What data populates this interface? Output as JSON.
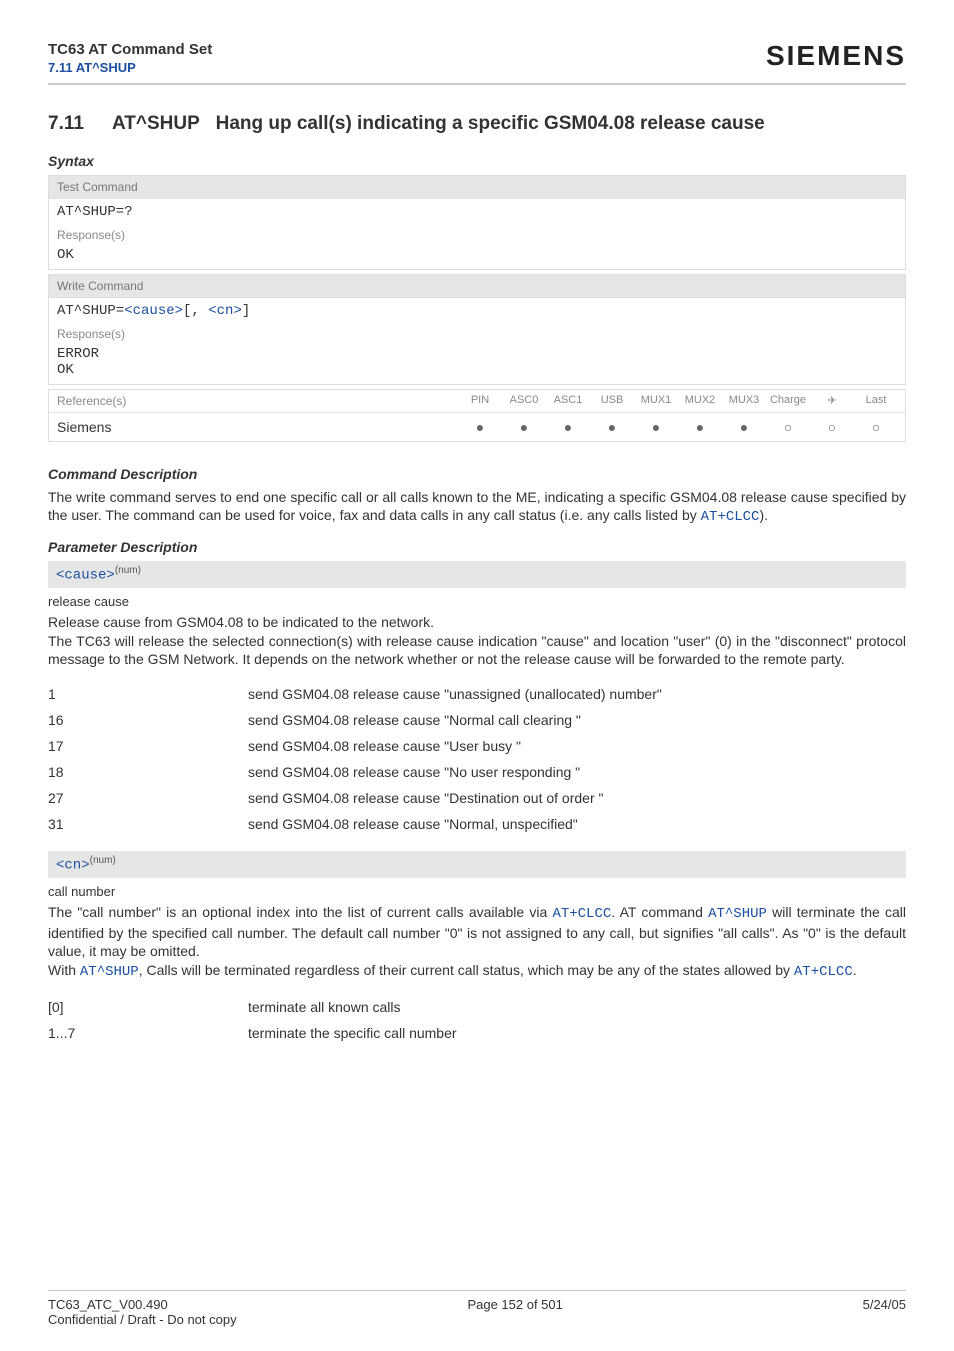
{
  "header": {
    "title": "TC63 AT Command Set",
    "sub": "7.11 AT^SHUP",
    "brand": "SIEMENS"
  },
  "section": {
    "num": "7.11",
    "cmd": "AT^SHUP",
    "title": "Hang up call(s) indicating a specific GSM04.08 release cause"
  },
  "syntax": {
    "label": "Syntax",
    "test": {
      "head": "Test Command",
      "cmd": "AT^SHUP=?",
      "resp_label": "Response(s)",
      "resp": "OK"
    },
    "write": {
      "head": "Write Command",
      "cmd_prefix": "AT^SHUP=",
      "param1": "<cause>",
      "sep": "[, ",
      "param2": "<cn>",
      "suffix": "]",
      "resp_label": "Response(s)",
      "resp1": "ERROR",
      "resp2": "OK"
    },
    "ref": {
      "label": "Reference(s)",
      "cols": [
        "PIN",
        "ASC0",
        "ASC1",
        "USB",
        "MUX1",
        "MUX2",
        "MUX3",
        "Charge",
        "✈",
        "Last"
      ],
      "vendor": "Siemens",
      "marks": [
        "●",
        "●",
        "●",
        "●",
        "●",
        "●",
        "●",
        "○",
        "○",
        "○"
      ]
    }
  },
  "cmd_desc": {
    "label": "Command Description",
    "text_before": "The write command serves to end one specific call or all calls known to the ME, indicating a specific GSM04.08 release cause specified by the user. The command can be used for voice, fax and data calls in any call status (i.e. any calls listed by ",
    "link": "AT+CLCC",
    "text_after": ")."
  },
  "param_desc": {
    "label": "Parameter Description",
    "cause": {
      "name": "<cause>",
      "type": "(num)",
      "sub": "release cause",
      "text": "Release cause from GSM04.08 to be indicated to the network.\nThe TC63 will release the selected connection(s) with release cause indication \"cause\" and location \"user\" (0) in the \"disconnect\" protocol message to the GSM Network. It depends on the network whether or not the release cause will be forwarded to the remote party.",
      "rows": [
        {
          "k": "1",
          "v": "send GSM04.08 release cause \"unassigned (unallocated) number\""
        },
        {
          "k": "16",
          "v": "send GSM04.08 release cause \"Normal call clearing \""
        },
        {
          "k": "17",
          "v": "send GSM04.08 release cause \"User busy \""
        },
        {
          "k": "18",
          "v": "send GSM04.08 release cause \"No user responding \""
        },
        {
          "k": "27",
          "v": "send GSM04.08 release cause \"Destination out of order \""
        },
        {
          "k": "31",
          "v": "send GSM04.08 release cause \"Normal, unspecified\""
        }
      ]
    },
    "cn": {
      "name": "<cn>",
      "type": "(num)",
      "sub": "call number",
      "text1": "The \"call number\" is an optional index into the list of current calls available via ",
      "link1": "AT+CLCC",
      "text2": ". AT command ",
      "link2": "AT^SHUP",
      "text3": " will terminate the call identified by the specified call number. The default call number \"0\" is not assigned to any call, but signifies \"all calls\". As \"0\" is the default value, it may be omitted.",
      "text4": "With ",
      "link3": "AT^SHUP",
      "text5": ", Calls will be terminated regardless of their current call status, which may be any of the states allowed by ",
      "link4": "AT+CLCC",
      "text6": ".",
      "rows": [
        {
          "k": "[0]",
          "v": "terminate all known calls",
          "link": null
        },
        {
          "k": "1...7",
          "v": "terminate the specific call number ",
          "link": "<cn>"
        }
      ]
    }
  },
  "footer": {
    "left": "TC63_ATC_V00.490",
    "center": "Page 152 of 501",
    "right": "5/24/05",
    "conf": "Confidential / Draft - Do not copy"
  }
}
